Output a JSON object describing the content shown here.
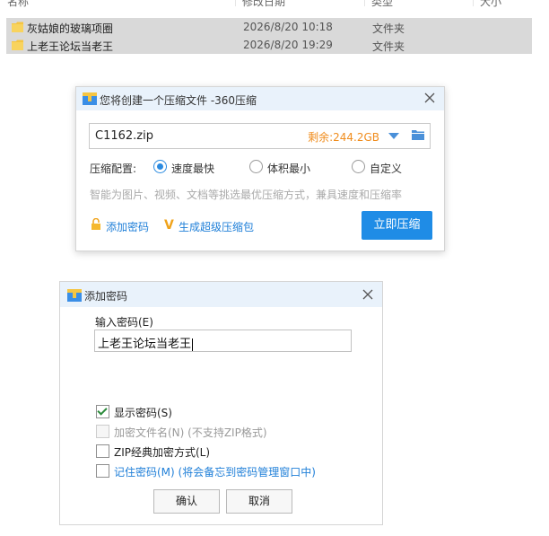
{
  "explorer": {
    "columns": [
      "名称",
      "修改日期",
      "类型",
      "大小"
    ],
    "rows": [
      {
        "name": "灰姑娘的玻璃项圈",
        "date": "2026/8/20 10:18",
        "type": "文件夹"
      },
      {
        "name": "上老王论坛当老王",
        "date": "2026/8/20 19:29",
        "type": "文件夹"
      }
    ]
  },
  "compress_dialog": {
    "title": "您将创建一个压缩文件 -360压缩",
    "filename": "C1162.zip",
    "space_left": "剩余:244.2GB",
    "config_label": "压缩配置:",
    "options": [
      "速度最快",
      "体积最小",
      "自定义"
    ],
    "selected_option": "速度最快",
    "hint": "智能为图片、视频、文档等挑选最优压缩方式，兼具速度和压缩率",
    "add_password": "添加密码",
    "vip_pack": "生成超级压缩包",
    "compress_button": "立即压缩"
  },
  "password_dialog": {
    "title": "添加密码",
    "input_label": "输入密码(E)",
    "password_value": "上老王论坛当老王",
    "checkboxes": [
      {
        "label": "显示密码(S)",
        "checked": true,
        "disabled": false
      },
      {
        "label": "加密文件名(N) (不支持ZIP格式)",
        "checked": false,
        "disabled": true
      },
      {
        "label": "ZIP经典加密方式(L)",
        "checked": false,
        "disabled": false
      },
      {
        "label": "记住密码(M) (将会备忘到密码管理窗口中)",
        "checked": false,
        "disabled": false
      }
    ],
    "ok_button": "确认",
    "cancel_button": "取消"
  },
  "colors": {
    "accent_blue": "#1f8ce6",
    "space_orange": "#f08c1c",
    "folder_yellow": "#f5c542",
    "titlebar_bg": "#e9f2fb"
  }
}
